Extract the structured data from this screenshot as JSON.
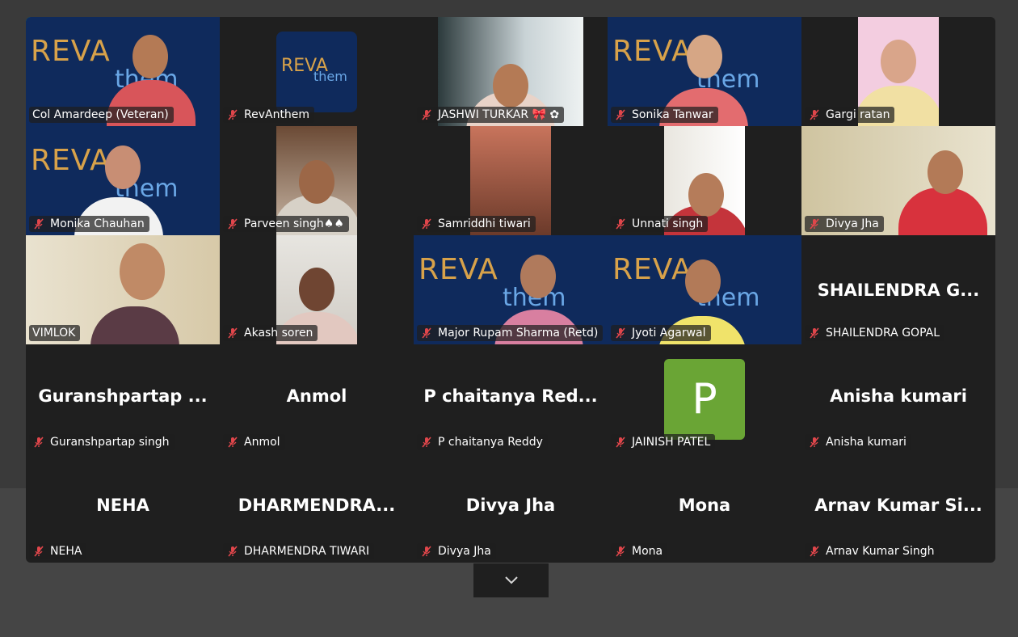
{
  "colors": {
    "speaking_border": "#23d18b",
    "mic_muted": "#e0464b",
    "avatar_bg": "#6aa535",
    "tile_bg": "#1f1f1f"
  },
  "brand": {
    "rev": "REVA",
    "them": "them",
    "logo_rev": "REVA",
    "logo_them": "them"
  },
  "tiles": [
    {
      "label": "Col Amardeep (Veteran)",
      "muted": false,
      "speaking": true
    },
    {
      "label": "RevAnthem",
      "muted": true
    },
    {
      "label": "JASHWI TURKAR 🎀 ✿",
      "muted": true
    },
    {
      "label": "Sonika Tanwar",
      "muted": true
    },
    {
      "label": "Gargi ratan",
      "muted": true
    },
    {
      "label": "Monika Chauhan",
      "muted": true
    },
    {
      "label": "Parveen singh♠♠",
      "muted": true
    },
    {
      "label": "Samriddhi tiwari",
      "muted": true
    },
    {
      "label": "Unnati singh",
      "muted": true
    },
    {
      "label": "Divya Jha",
      "muted": true
    },
    {
      "label": "VIMLOK",
      "muted": false
    },
    {
      "label": "Akash soren",
      "muted": true
    },
    {
      "label": "Major Rupam Sharma (Retd)",
      "muted": true
    },
    {
      "label": "Jyoti Agarwal",
      "muted": true
    },
    {
      "label": "SHAILENDRA GOPAL",
      "muted": true,
      "display": "SHAILENDRA  G..."
    },
    {
      "label": "Guranshpartap singh",
      "muted": true,
      "display": "Guranshpartap ..."
    },
    {
      "label": "Anmol",
      "muted": true,
      "display": "Anmol"
    },
    {
      "label": "P chaitanya Reddy",
      "muted": true,
      "display": "P  chaitanya  Red..."
    },
    {
      "label": "JAINISH PATEL",
      "muted": true,
      "avatar_letter": "P"
    },
    {
      "label": "Anisha kumari",
      "muted": true,
      "display": "Anisha kumari"
    },
    {
      "label": "NEHA",
      "muted": true,
      "display": "NEHA"
    },
    {
      "label": "DHARMENDRA TIWARI",
      "muted": true,
      "display": "DHARMENDRA..."
    },
    {
      "label": "Divya Jha",
      "muted": true,
      "display": "Divya Jha"
    },
    {
      "label": "Mona",
      "muted": true,
      "display": "Mona"
    },
    {
      "label": "Arnav  Kumar Singh",
      "muted": true,
      "display": "Arnav   Kumar  Si..."
    }
  ],
  "controls": {
    "expand_icon": "chevron-down-icon"
  }
}
